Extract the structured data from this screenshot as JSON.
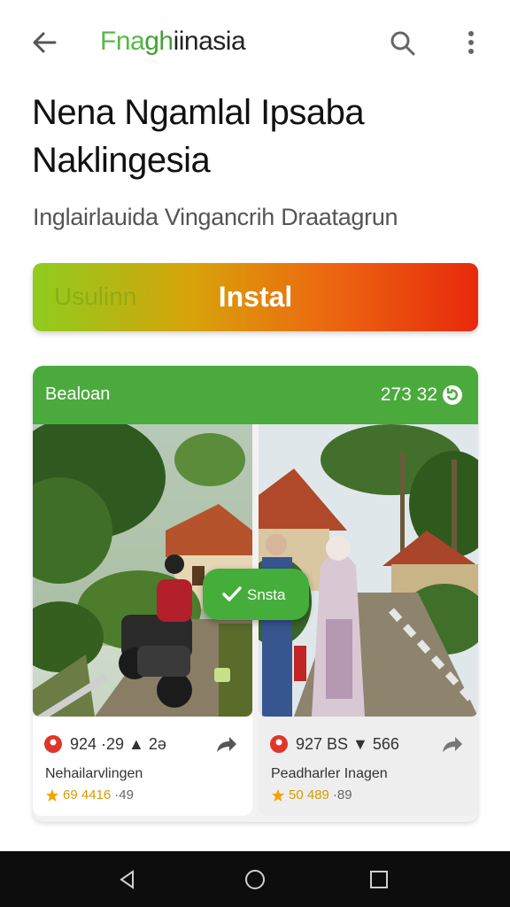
{
  "app_bar": {
    "brand_part1": "Fna",
    "brand_part2": "gh",
    "brand_part3": "iinasia",
    "back_icon": "arrow-left-icon",
    "search_icon": "search-icon",
    "more_icon": "more-vertical-icon"
  },
  "heading": {
    "title_line1": "Nena Ngamlal Ipsaba",
    "title_line2": "Naklingesia",
    "subtitle": "Inglairlauida Vingancrih Draatagrun"
  },
  "install_button": {
    "ghost_label": "Usulinn",
    "label": "Instal",
    "colors": [
      "#8fcc1e",
      "#ec6a10",
      "#e8290c"
    ]
  },
  "card": {
    "header_label": "Bealoan",
    "header_count": "273 32",
    "header_color": "#4aab3c",
    "items": [
      {
        "stats": "924 ·29 ▲ 2ə",
        "name": "Nehailarvlingen",
        "rating": "69 4416",
        "rating_suffix": "·49"
      },
      {
        "stats": "927 BS ▼ 566",
        "name": "Peadharler Inagen",
        "rating": "50 489",
        "rating_suffix": "·89"
      }
    ]
  },
  "overlay_badge": {
    "label": "Snsta",
    "icon": "check-icon"
  },
  "system_nav": {
    "back": "nav-back-icon",
    "home": "nav-home-icon",
    "recents": "nav-recents-icon"
  }
}
